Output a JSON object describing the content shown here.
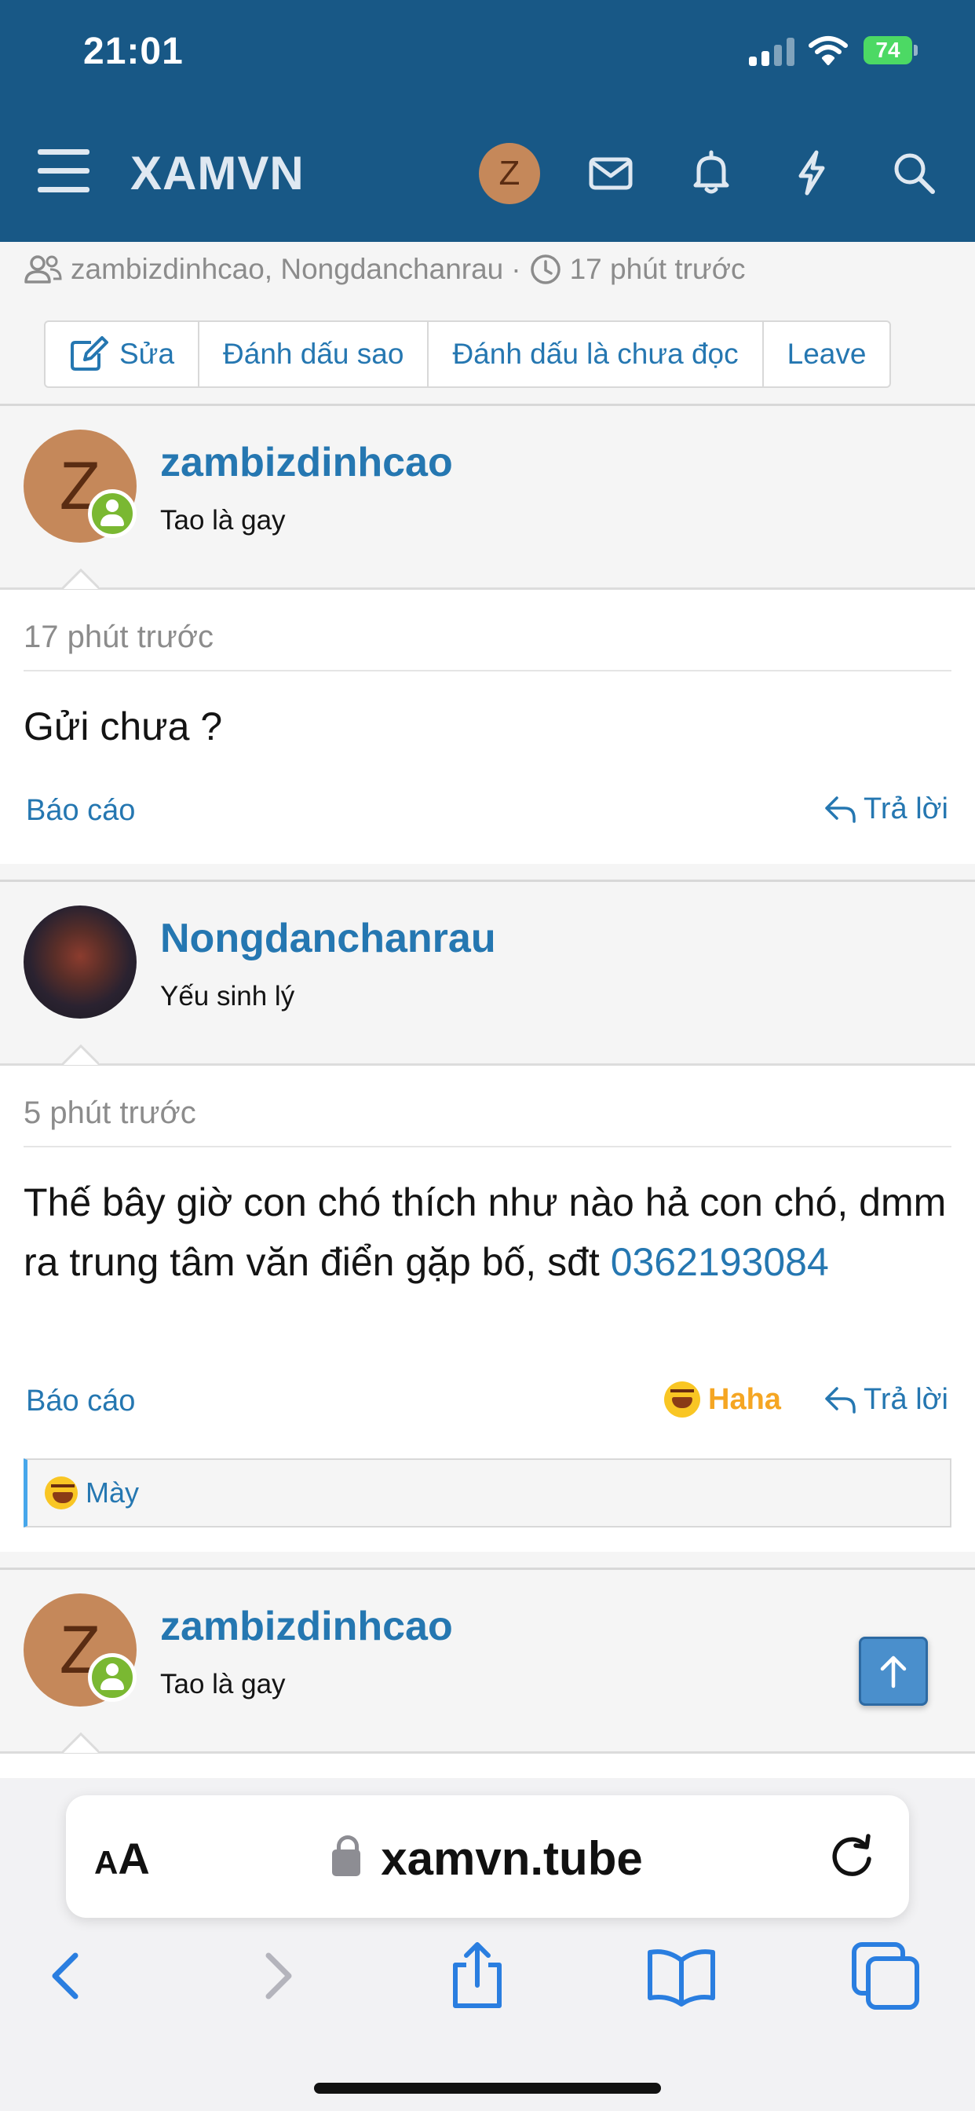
{
  "status_bar": {
    "time": "21:01",
    "battery": "74"
  },
  "header": {
    "logo": "XAMVN",
    "avatar_letter": "Z"
  },
  "thread_meta": {
    "participants": "zambizdinhcao, Nongdanchanrau",
    "separator": "·",
    "time": "17 phút trước"
  },
  "actions": {
    "edit": "Sửa",
    "star": "Đánh dấu sao",
    "unread": "Đánh dấu là chưa đọc",
    "leave": "Leave"
  },
  "posts": [
    {
      "username": "zambizdinhcao",
      "avatar_letter": "Z",
      "user_title": "Tao là gay",
      "time": "17 phút trước",
      "message": "Gửi chưa ?",
      "report": "Báo cáo",
      "reply": "Trả lời"
    },
    {
      "username": "Nongdanchanrau",
      "user_title": "Yếu sinh lý",
      "time": "5 phút trước",
      "message": "Thế bây giờ con chó thích như nào hả con chó, dmm ra trung tâm văn điển gặp bố, sđt ",
      "phone": "0362193084",
      "report": "Báo cáo",
      "reaction": "Haha",
      "reply": "Trả lời",
      "reacted_by": "Mày"
    },
    {
      "username": "zambizdinhcao",
      "avatar_letter": "Z",
      "user_title": "Tao là gay"
    }
  ],
  "browser": {
    "aa_small": "A",
    "aa_big": "A",
    "url": "xamvn.tube"
  },
  "colors": {
    "header": "#185886",
    "link": "#2577b1",
    "reaction": "#f5a623",
    "online": "#7ab832"
  }
}
